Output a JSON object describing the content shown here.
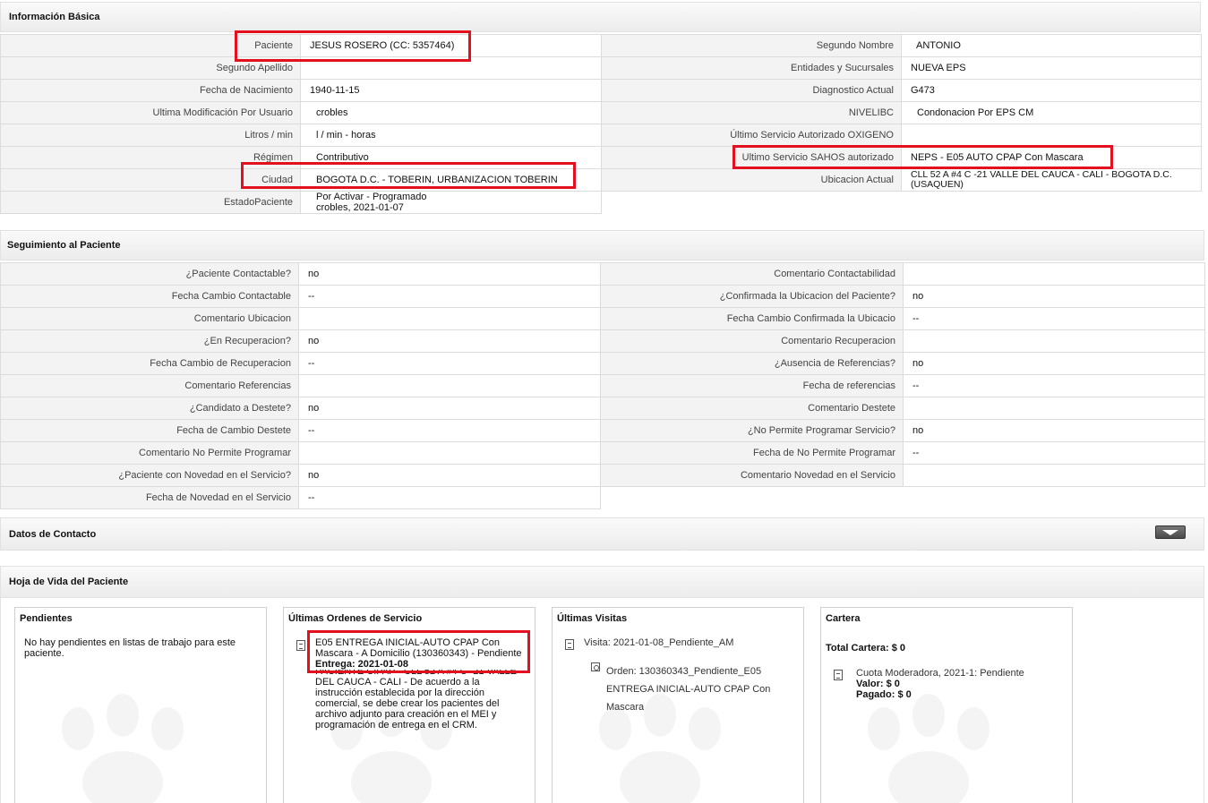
{
  "basica": {
    "title": "Información Básica",
    "left": [
      {
        "label": "Paciente",
        "value": "JESUS ROSERO (CC: 5357464)"
      },
      {
        "label": "Segundo Apellido",
        "value": ""
      },
      {
        "label": "Fecha de Nacimiento",
        "value": "1940-11-15"
      },
      {
        "label": "Ultima Modificación Por Usuario",
        "value": "crobles"
      },
      {
        "label": "Litros / min",
        "value": "l / min - horas"
      },
      {
        "label": "Régimen",
        "value": "Contributivo"
      },
      {
        "label": "Ciudad",
        "value": "BOGOTA D.C. - TOBERIN, URBANIZACION TOBERIN"
      },
      {
        "label": "EstadoPaciente",
        "value": "Por Activar - Programado",
        "value2": "crobles, 2021-01-07"
      }
    ],
    "right": [
      {
        "label": "Segundo Nombre",
        "value": "ANTONIO"
      },
      {
        "label": "Entidades y Sucursales",
        "value": "NUEVA EPS"
      },
      {
        "label": "Diagnostico Actual",
        "value": "G473"
      },
      {
        "label": "NIVELIBC",
        "value": "Condonacion Por EPS CM"
      },
      {
        "label": "Último Servicio Autorizado OXIGENO",
        "value": ""
      },
      {
        "label": "Ultimo Servicio SAHOS autorizado",
        "value": "NEPS - E05 AUTO CPAP Con Mascara"
      },
      {
        "label": "Ubicacion Actual",
        "value": "CLL 52 A #4 C -21 VALLE DEL CAUCA - CALI - BOGOTA D.C. (USAQUEN)"
      }
    ]
  },
  "seguimiento": {
    "title": "Seguimiento al Paciente",
    "left": [
      {
        "label": "¿Paciente Contactable?",
        "value": "no"
      },
      {
        "label": "Fecha Cambio Contactable",
        "value": "--"
      },
      {
        "label": "Comentario Ubicacion",
        "value": ""
      },
      {
        "label": "¿En Recuperacion?",
        "value": "no"
      },
      {
        "label": "Fecha Cambio de Recuperacion",
        "value": "--"
      },
      {
        "label": "Comentario Referencias",
        "value": ""
      },
      {
        "label": "¿Candidato a Destete?",
        "value": "no"
      },
      {
        "label": "Fecha de Cambio Destete",
        "value": "--"
      },
      {
        "label": "Comentario No Permite Programar",
        "value": ""
      },
      {
        "label": "¿Paciente con Novedad en el Servicio?",
        "value": "no"
      },
      {
        "label": "Fecha de Novedad en el Servicio",
        "value": "--"
      }
    ],
    "right": [
      {
        "label": "Comentario Contactabilidad",
        "value": ""
      },
      {
        "label": "¿Confirmada la Ubicacion del Paciente?",
        "value": "no"
      },
      {
        "label": "Fecha Cambio Confirmada la Ubicacio",
        "value": "--"
      },
      {
        "label": "Comentario Recuperacion",
        "value": ""
      },
      {
        "label": "¿Ausencia de Referencias?",
        "value": "no"
      },
      {
        "label": "Fecha de referencias",
        "value": "--"
      },
      {
        "label": "Comentario Destete",
        "value": ""
      },
      {
        "label": "¿No Permite Programar Servicio?",
        "value": "no"
      },
      {
        "label": "Fecha de No Permite Programar",
        "value": "--"
      },
      {
        "label": "Comentario Novedad en el Servicio",
        "value": ""
      }
    ]
  },
  "contacto": {
    "title": "Datos de Contacto"
  },
  "hoja": {
    "title": "Hoja de Vida del Paciente",
    "pendientes": {
      "title": "Pendientes",
      "text": "No hay pendientes en listas de trabajo para este paciente."
    },
    "ordenes": {
      "title": "Últimas Ordenes de Servicio",
      "line1": "E05 ENTREGA INICIAL-AUTO CPAP Con",
      "line2": "Mascara - A Domicilio (130360343) - Pendiente",
      "entrega": "Entrega: 2021-01-08",
      "line4": "PACIENTE CIPAP - CLL 52 A #4 C -21 VALLE",
      "line5": "DEL CAUCA - CALI - De acuerdo a la",
      "line6": "instrucción establecida por la dirección",
      "line7": "comercial, se debe crear los pacientes del",
      "line8": "archivo adjunto para creación en el MEI y",
      "line9": "programación de entrega en el CRM."
    },
    "visitas": {
      "title": "Últimas Visitas",
      "visita": "Visita: 2021-01-08_Pendiente_AM",
      "orden1": "Orden: 130360343_Pendiente_E05",
      "orden2": "ENTREGA INICIAL-AUTO CPAP Con",
      "orden3": "Mascara"
    },
    "cartera": {
      "title": "Cartera",
      "total": "Total Cartera: $ 0",
      "cuota": "Cuota Moderadora, 2021-1: Pendiente",
      "valor": "Valor: $ 0",
      "pagado": "Pagado: $ 0"
    }
  }
}
